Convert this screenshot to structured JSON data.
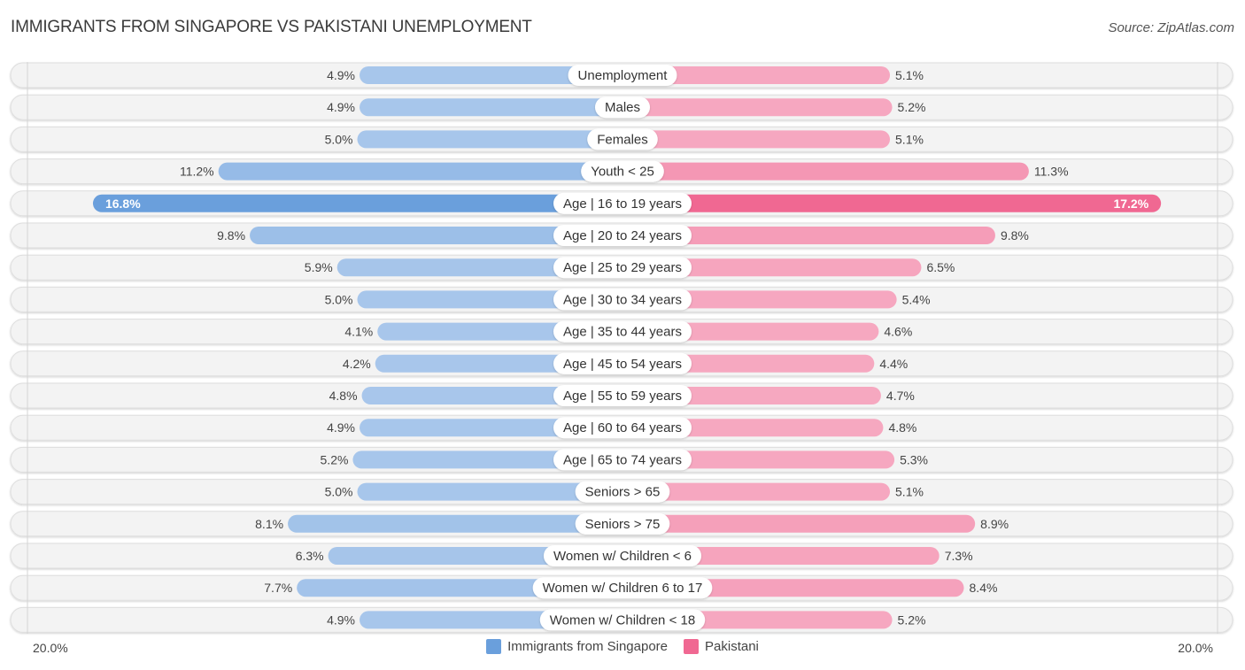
{
  "header": {
    "title": "IMMIGRANTS FROM SINGAPORE VS PAKISTANI UNEMPLOYMENT",
    "source": "Source: ZipAtlas.com"
  },
  "colors": {
    "series_a_light": "#a9c7eb",
    "series_a_dark": "#6a9fdc",
    "series_b_light": "#f6a9c1",
    "series_b_dark": "#f06892",
    "row_bg": "#f3f3f3",
    "row_border": "#dedede"
  },
  "legend": {
    "items": [
      {
        "label": "Immigrants from Singapore",
        "color": "#6a9fdc"
      },
      {
        "label": "Pakistani",
        "color": "#f06892"
      }
    ]
  },
  "axis": {
    "left_label": "20.0%",
    "right_label": "20.0%"
  },
  "chart_data": {
    "type": "bar",
    "orientation": "diverging-horizontal",
    "title": "IMMIGRANTS FROM SINGAPORE VS PAKISTANI UNEMPLOYMENT",
    "xlabel": "",
    "ylabel": "",
    "xlim": [
      0,
      20
    ],
    "unit": "%",
    "legend_position": "bottom-center",
    "grid": false,
    "categories": [
      "Unemployment",
      "Males",
      "Females",
      "Youth < 25",
      "Age | 16 to 19 years",
      "Age | 20 to 24 years",
      "Age | 25 to 29 years",
      "Age | 30 to 34 years",
      "Age | 35 to 44 years",
      "Age | 45 to 54 years",
      "Age | 55 to 59 years",
      "Age | 60 to 64 years",
      "Age | 65 to 74 years",
      "Seniors > 65",
      "Seniors > 75",
      "Women w/ Children < 6",
      "Women w/ Children 6 to 17",
      "Women w/ Children < 18"
    ],
    "series": [
      {
        "name": "Immigrants from Singapore",
        "side": "left",
        "values": [
          4.9,
          4.9,
          5.0,
          11.2,
          16.8,
          9.8,
          5.9,
          5.0,
          4.1,
          4.2,
          4.8,
          4.9,
          5.2,
          5.0,
          8.1,
          6.3,
          7.7,
          4.9
        ],
        "labels": [
          "4.9%",
          "4.9%",
          "5.0%",
          "11.2%",
          "16.8%",
          "9.8%",
          "5.9%",
          "5.0%",
          "4.1%",
          "4.2%",
          "4.8%",
          "4.9%",
          "5.2%",
          "5.0%",
          "8.1%",
          "6.3%",
          "7.7%",
          "4.9%"
        ]
      },
      {
        "name": "Pakistani",
        "side": "right",
        "values": [
          5.1,
          5.2,
          5.1,
          11.3,
          17.2,
          9.8,
          6.5,
          5.4,
          4.6,
          4.4,
          4.7,
          4.8,
          5.3,
          5.1,
          8.9,
          7.3,
          8.4,
          5.2
        ],
        "labels": [
          "5.1%",
          "5.2%",
          "5.1%",
          "11.3%",
          "17.2%",
          "9.8%",
          "6.5%",
          "5.4%",
          "4.6%",
          "4.4%",
          "4.7%",
          "4.8%",
          "5.3%",
          "5.1%",
          "8.9%",
          "7.3%",
          "8.4%",
          "5.2%"
        ]
      }
    ]
  }
}
